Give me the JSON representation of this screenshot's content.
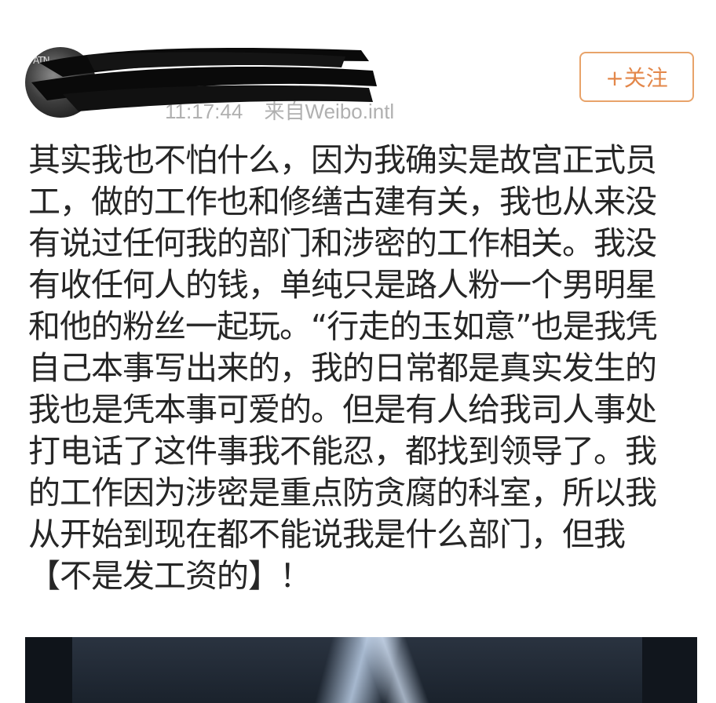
{
  "header": {
    "avatar_text": "ATN",
    "meta_time": "11:17:44",
    "meta_source": "来自Weibo.intl",
    "follow_label": "+关注"
  },
  "post": {
    "lines": [
      "其实我也不怕什么，因为我确实是故宫正式员",
      "工，做的工作也和修缮古建有关，我也从来没",
      "有说过任何我的部门和涉密的工作相关。我没",
      "有收任何人的钱，单纯只是路人粉一个男明星",
      "和他的粉丝一起玩。“行走的玉如意”也是我凭",
      "自己本事写出来的，我的日常都是真实发生的",
      "我也是凭本事可爱的。但是有人给我司人事处",
      "打电话了这件事我不能忍，都找到领导了。我",
      "的工作因为涉密是重点防贪腐的科室，所以我",
      "从开始到现在都不能说我是什么部门，但我",
      "【不是发工资的】！"
    ]
  },
  "colors": {
    "follow_border": "#e8a36a",
    "follow_text": "#e3874a",
    "meta_text": "#b0b0b0",
    "body_text": "#262626"
  }
}
